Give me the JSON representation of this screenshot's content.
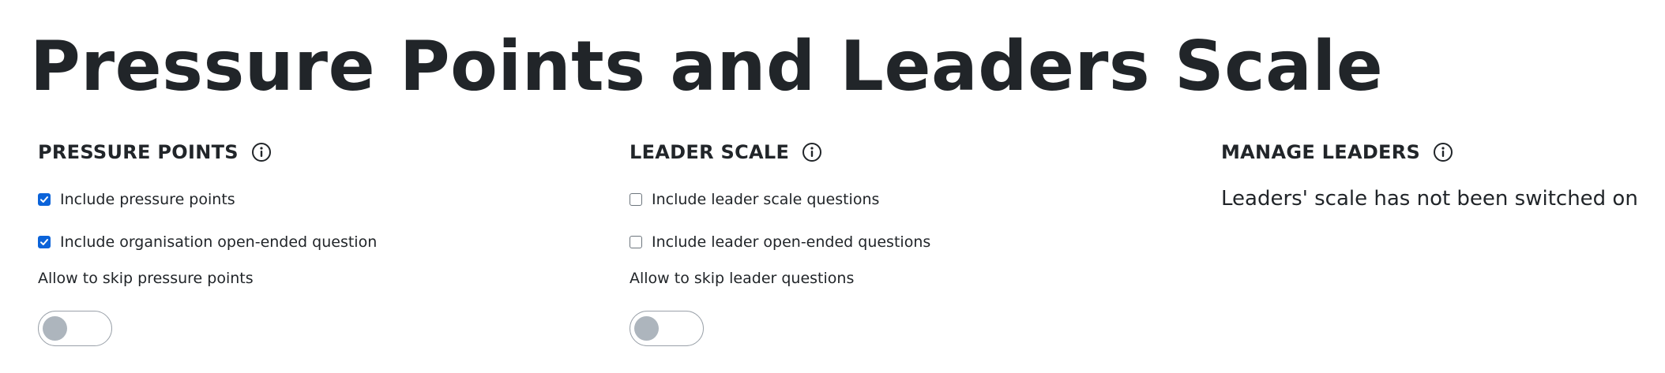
{
  "page": {
    "title": "Pressure Points and Leaders Scale"
  },
  "pressure_points": {
    "heading": "PRESSURE POINTS",
    "info_icon": "info-circle-icon",
    "include_pressure_points": {
      "label": "Include pressure points",
      "checked": true
    },
    "include_org_open_ended": {
      "label": "Include organisation open-ended question",
      "checked": true
    },
    "skip_label": "Allow to skip pressure points",
    "skip_toggle_on": false
  },
  "leader_scale": {
    "heading": "LEADER SCALE",
    "info_icon": "info-circle-icon",
    "include_leader_scale": {
      "label": "Include leader scale questions",
      "checked": false
    },
    "include_leader_open_ended": {
      "label": "Include leader open-ended questions",
      "checked": false
    },
    "skip_label": "Allow to skip leader questions",
    "skip_toggle_on": false
  },
  "manage_leaders": {
    "heading": "MANAGE LEADERS",
    "info_icon": "info-circle-icon",
    "status_text": "Leaders' scale has not been switched on"
  },
  "colors": {
    "text": "#212529",
    "checkbox_checked": "#0b63d9",
    "toggle_knob_off": "#adb5bd",
    "toggle_border": "#9aa1a9"
  }
}
